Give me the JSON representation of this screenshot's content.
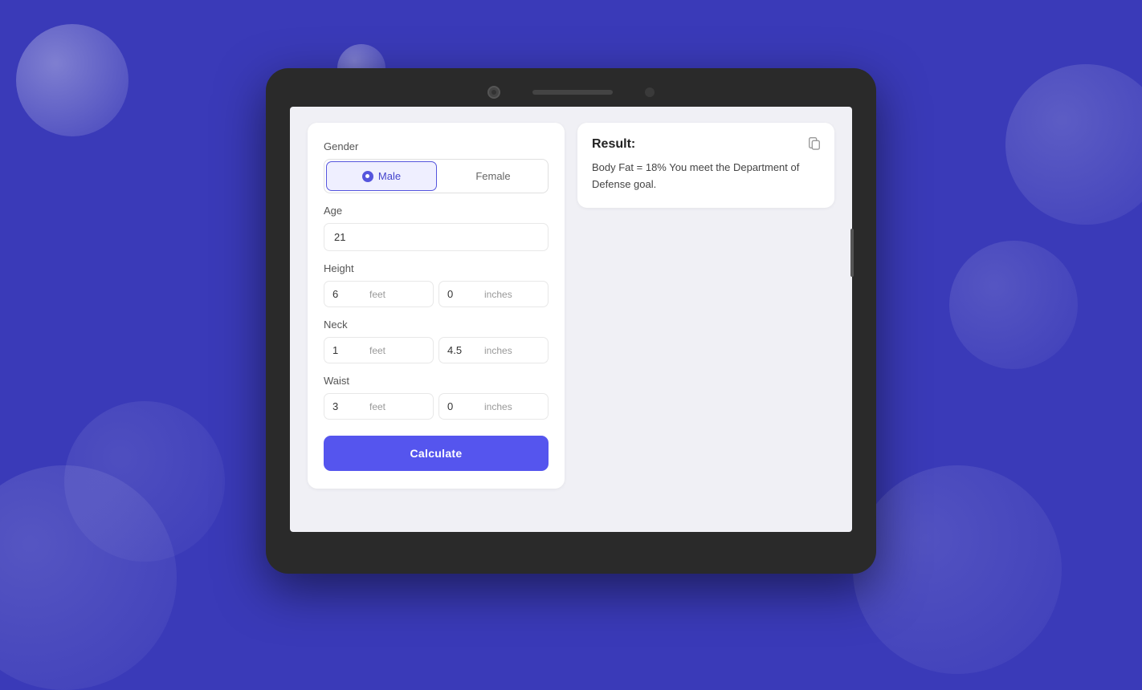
{
  "background": {
    "color": "#3a3ab8"
  },
  "form": {
    "gender_label": "Gender",
    "male_label": "Male",
    "female_label": "Female",
    "age_label": "Age",
    "age_value": "21",
    "height_label": "Height",
    "height_feet_value": "6",
    "height_feet_unit": "feet",
    "height_inches_value": "0",
    "height_inches_unit": "inches",
    "neck_label": "Neck",
    "neck_feet_value": "1",
    "neck_feet_unit": "feet",
    "neck_inches_value": "4.5",
    "neck_inches_unit": "inches",
    "waist_label": "Waist",
    "waist_feet_value": "3",
    "waist_feet_unit": "feet",
    "waist_inches_value": "0",
    "waist_inches_unit": "inches",
    "calculate_label": "Calculate"
  },
  "result": {
    "title": "Result:",
    "body": "Body Fat = 18% You meet the Department of Defense goal."
  }
}
